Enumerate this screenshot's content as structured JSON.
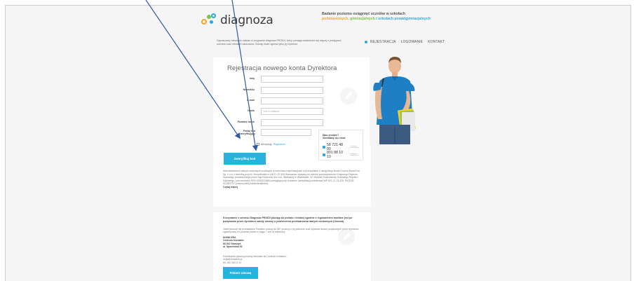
{
  "header": {
    "logo_text": "diagnoza",
    "tagline_line1": "Badanie poziomu osiągnięć uczniów w szkołach",
    "tagline_a": "podstawowych,",
    "tagline_b": "gimnazjalnych",
    "tagline_c": "i szkołach ponadgimnazjalnych",
    "intro": "Zapraszamy szkoły do udziału w programie diagnoza PROIDI, który pomaga dowiedzieć się więcej o postępach uczniów oraz efektach nauczania. Szkołę może zgłosić tylko jej Dyrektor."
  },
  "nav": {
    "items": [
      "REJESTRACJA",
      "LOGOWANIE",
      "KONTAKT"
    ]
  },
  "form": {
    "title": "Rejestracja nowego konta Dyrektora",
    "fields": [
      {
        "label": "Imię",
        "placeholder": ""
      },
      {
        "label": "Nazwisko",
        "placeholder": ""
      },
      {
        "label": "E-mail",
        "placeholder": ""
      },
      {
        "label": "Hasło",
        "placeholder": "min 6 znaków"
      },
      {
        "label": "Powtórz hasło",
        "placeholder": ""
      }
    ],
    "captcha_label": "Podaj kod weryfikujący",
    "accept_text": "Akceptuję",
    "accept_link": "Regulamin",
    "verify_button": "Zweryfikuj kod",
    "admin_text": "Administratorem danych osobowych podanych w formularzu rejestracyjnym na korzystanie z usługi Moja Nowa Era jest Nowa Era Sp. z o.o. z siedzibą przy Al. Jerozolimskich 146 D, 02-305 Warszawa, wpisaną do rejestru przedsiębiorców Krajowego Rejestru Sądowego prowadzonego przez Sąd Rejonowy dla m.st. Warszawy w Warszawie, XII Wydział Gospodarczy Krajowego Rejestru Sądowego, pod numerem KRS 0000021668 posługującą się numerem identyfikacji podatkowej NIP 521-11-74-876, REGON 012381737 (zwanej dalej Administratorem).",
    "read_more": "Czytaj więcej"
  },
  "help": {
    "title_line1": "Masz problem?",
    "title_line2": "Skontaktuj się z nami",
    "phones": [
      {
        "number": "58 721 48 00",
        "note": "z telefonów stacjonarnych"
      },
      {
        "number": "801 88 10 10",
        "note": "z telefonów komórkowych"
      }
    ]
  },
  "card2": {
    "heading": "Korzystanie z serwisu Diagnoza PROIDI (dostęp do portalu i testów) zgodnie z regulaminem możliwe jest po podpisaniu przez dyrektora szkoły umowy o powierzeniu przetwarzania danych osobowych (Umowa).",
    "body": "Jeżeli jeszcze nie przesłaliście Państwo umowy do NE, prosimy o jej pobranie oraz wysłanie dwóch podpisanych przez dyrektora egzemplarzy na poniższy adres w ciągu 7 dni od rejestracji.",
    "addr_lines": [
      "NOWA ERA",
      "Centrum Kontaktu",
      "83-010 Straszyn",
      "ul. Spacerowa 30"
    ],
    "contact_lines": [
      "Ewentualne pytania prosimy kierować do Centrum Kontaktu:",
      "moja@nowaera.pl",
      "tel.: 801 88 10 10"
    ],
    "download_button": "Pobierz umowę"
  },
  "colors": {
    "accent": "#27b4dc",
    "orange": "#f5a623",
    "green": "#7cc243",
    "annotation_arrow": "#2d5aa0"
  }
}
